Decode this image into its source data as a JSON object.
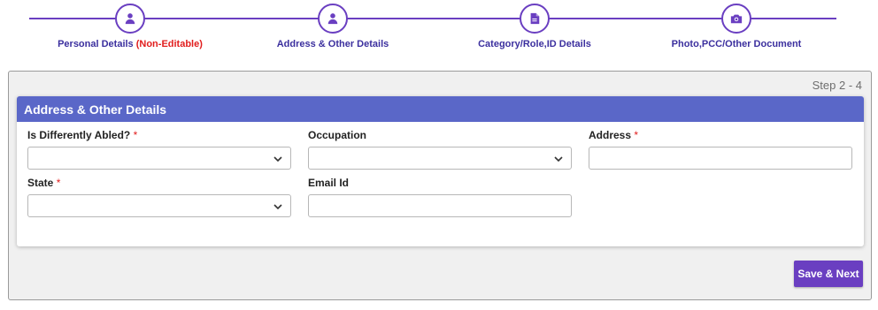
{
  "stepper": {
    "steps": [
      {
        "label": "Personal Details",
        "note": "(Non-Editable)",
        "icon": "user-icon"
      },
      {
        "label": "Address & Other Details",
        "note": "",
        "icon": "user-icon"
      },
      {
        "label": "Category/Role,ID Details",
        "note": "",
        "icon": "document-icon"
      },
      {
        "label": "Photo,PCC/Other Document",
        "note": "",
        "icon": "camera-icon"
      }
    ]
  },
  "panel": {
    "step_indicator": "Step 2 - 4",
    "title": "Address & Other Details"
  },
  "form": {
    "differently_abled": {
      "label": "Is Differently Abled?",
      "required": "*",
      "value": ""
    },
    "occupation": {
      "label": "Occupation",
      "value": ""
    },
    "address": {
      "label": "Address",
      "required": "*",
      "value": ""
    },
    "state": {
      "label": "State",
      "required": "*",
      "value": ""
    },
    "email": {
      "label": "Email Id",
      "value": ""
    }
  },
  "actions": {
    "save_next_label": "Save & Next"
  },
  "colors": {
    "accent": "#6a3fc1",
    "header": "#5a67c8",
    "required": "#e11d1d"
  }
}
